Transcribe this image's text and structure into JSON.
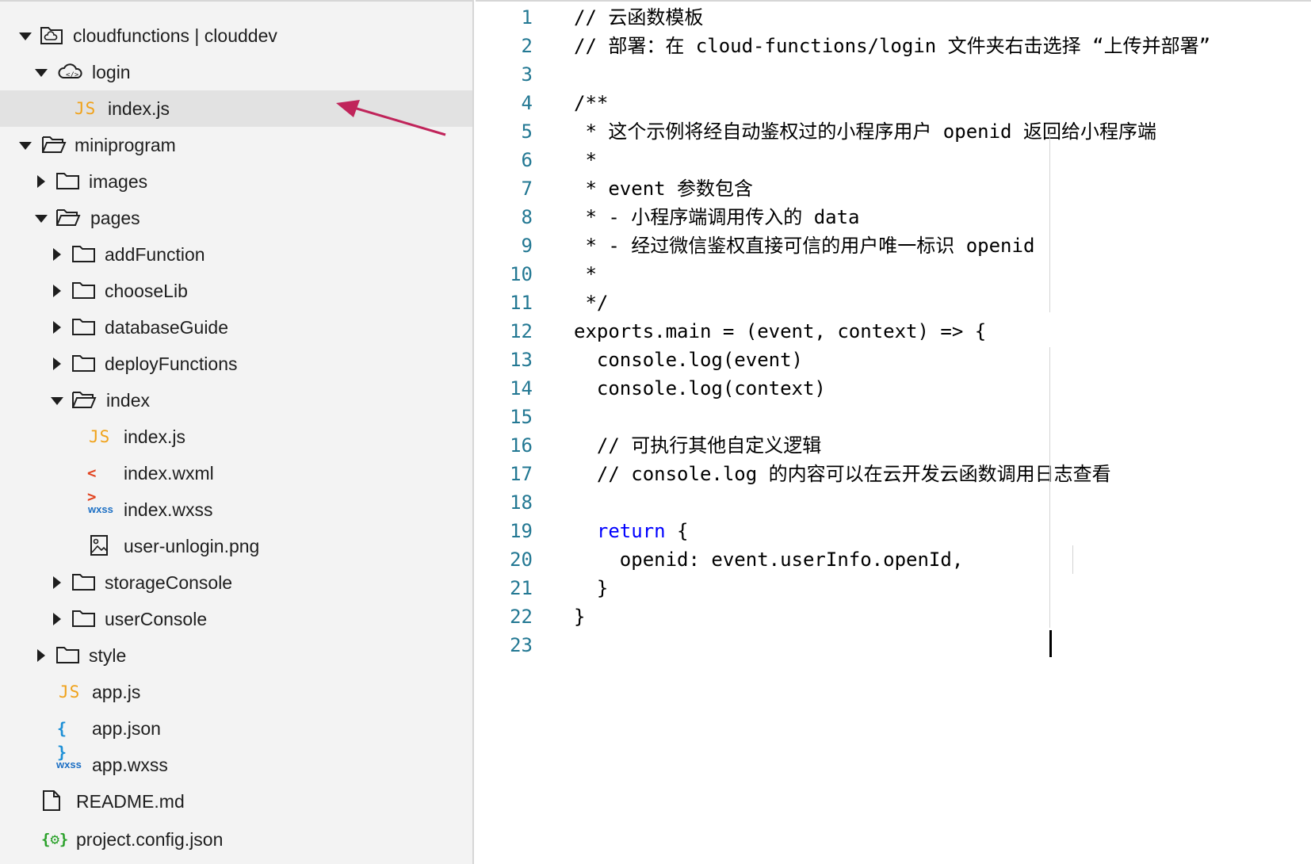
{
  "tree": [
    {
      "label": "cloudfunctions | clouddev",
      "icon": "cloud-folder-icon",
      "caret": "down"
    },
    {
      "label": "login",
      "icon": "cloud-function-icon",
      "caret": "down"
    },
    {
      "label": "index.js",
      "icon": "js-file-icon",
      "caret": "",
      "icon_text": "JS",
      "selected": true
    },
    {
      "label": "miniprogram",
      "icon": "folder-open-icon",
      "caret": "down"
    },
    {
      "label": "images",
      "icon": "folder-icon",
      "caret": "right"
    },
    {
      "label": "pages",
      "icon": "folder-open-icon",
      "caret": "down"
    },
    {
      "label": "addFunction",
      "icon": "folder-icon",
      "caret": "right"
    },
    {
      "label": "chooseLib",
      "icon": "folder-icon",
      "caret": "right"
    },
    {
      "label": "databaseGuide",
      "icon": "folder-icon",
      "caret": "right"
    },
    {
      "label": "deployFunctions",
      "icon": "folder-icon",
      "caret": "right"
    },
    {
      "label": "index",
      "icon": "folder-open-icon",
      "caret": "down"
    },
    {
      "label": "index.js",
      "icon": "js-file-icon",
      "caret": "",
      "icon_text": "JS"
    },
    {
      "label": "index.wxml",
      "icon": "wxml-file-icon",
      "caret": "",
      "icon_text": "< >"
    },
    {
      "label": "index.wxss",
      "icon": "wxss-file-icon",
      "caret": "",
      "icon_text": "wxss"
    },
    {
      "label": "user-unlogin.png",
      "icon": "image-file-icon",
      "caret": ""
    },
    {
      "label": "storageConsole",
      "icon": "folder-icon",
      "caret": "right"
    },
    {
      "label": "userConsole",
      "icon": "folder-icon",
      "caret": "right"
    },
    {
      "label": "style",
      "icon": "folder-icon",
      "caret": "right"
    },
    {
      "label": "app.js",
      "icon": "js-file-icon",
      "caret": "",
      "icon_text": "JS"
    },
    {
      "label": "app.json",
      "icon": "json-file-icon",
      "caret": "",
      "icon_text": "{ }"
    },
    {
      "label": "app.wxss",
      "icon": "wxss-file-icon",
      "caret": "",
      "icon_text": "wxss"
    },
    {
      "label": "README.md",
      "icon": "file-icon",
      "caret": ""
    },
    {
      "label": "project.config.json",
      "icon": "config-file-icon",
      "caret": "",
      "icon_text": "{⚙}"
    }
  ],
  "editor": {
    "lines": [
      {
        "num": "1",
        "text": "// 云函数模板",
        "kind": "comment"
      },
      {
        "num": "2",
        "text": "// 部署：在 cloud-functions/login 文件夹右击选择 “上传并部署”",
        "kind": "comment"
      },
      {
        "num": "3",
        "text": "",
        "kind": "plain"
      },
      {
        "num": "4",
        "text": "/**",
        "kind": "comment"
      },
      {
        "num": "5",
        "text": " * 这个示例将经自动鉴权过的小程序用户 openid 返回给小程序端",
        "kind": "comment"
      },
      {
        "num": "6",
        "text": " *",
        "kind": "comment"
      },
      {
        "num": "7",
        "text": " * event 参数包含",
        "kind": "comment"
      },
      {
        "num": "8",
        "text": " * - 小程序端调用传入的 data",
        "kind": "comment"
      },
      {
        "num": "9",
        "text": " * - 经过微信鉴权直接可信的用户唯一标识 openid",
        "kind": "comment"
      },
      {
        "num": "10",
        "text": " *",
        "kind": "comment"
      },
      {
        "num": "11",
        "text": " */",
        "kind": "comment"
      },
      {
        "num": "12",
        "text": "exports.main = (event, context) => {",
        "kind": "plain"
      },
      {
        "num": "13",
        "text": "  console.log(event)",
        "kind": "plain"
      },
      {
        "num": "14",
        "text": "  console.log(context)",
        "kind": "plain"
      },
      {
        "num": "15",
        "text": "",
        "kind": "plain"
      },
      {
        "num": "16",
        "text": "  // 可执行其他自定义逻辑",
        "kind": "comment"
      },
      {
        "num": "17",
        "text": "  // console.log 的内容可以在云开发云函数调用日志查看",
        "kind": "comment"
      },
      {
        "num": "18",
        "text": "",
        "kind": "plain"
      },
      {
        "num": "19",
        "text": "  return {",
        "kind": "return"
      },
      {
        "num": "20",
        "text": "    openid: event.userInfo.openId,",
        "kind": "plain"
      },
      {
        "num": "21",
        "text": "  }",
        "kind": "plain"
      },
      {
        "num": "22",
        "text": "}",
        "kind": "plain"
      },
      {
        "num": "23",
        "text": "",
        "kind": "plain"
      }
    ],
    "return_keyword": "return",
    "return_rest": " {"
  },
  "colors": {
    "comment": "#008000",
    "keyword": "#0000ff",
    "line_number": "#237893",
    "arrow": "#c0245a"
  }
}
